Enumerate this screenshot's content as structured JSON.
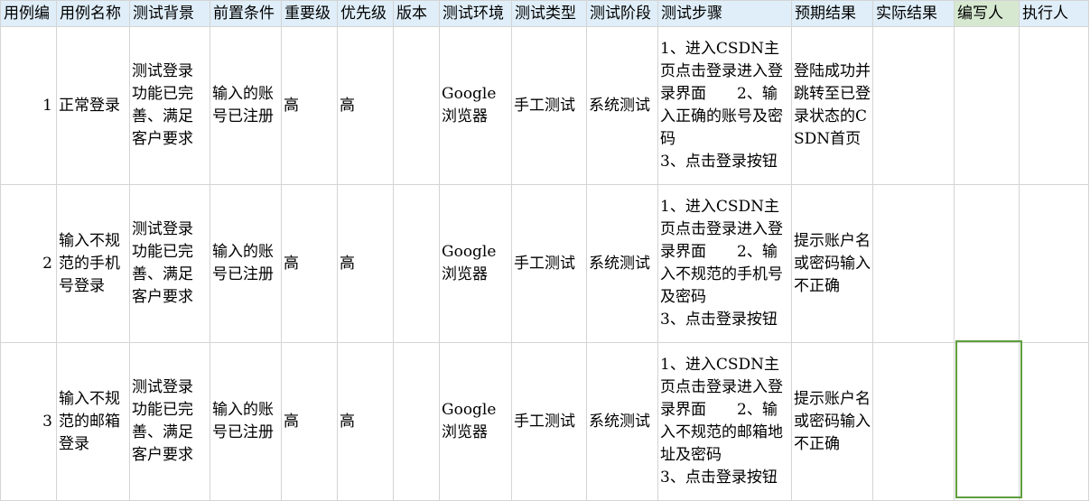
{
  "headers": [
    "用例编",
    "用例名称",
    "测试背景",
    "前置条件",
    "重要级",
    "优先级",
    "版本",
    "测试环境",
    "测试类型",
    "测试阶段",
    "测试步骤",
    "预期结果",
    "实际结果",
    "编写人",
    "执行人"
  ],
  "rows": [
    {
      "id": "1",
      "name": "正常登录",
      "background": "测试登录功能已完善、满足客户要求",
      "precondition": "输入的账号已注册",
      "importance": "高",
      "priority": "高",
      "version": "",
      "env": "Google浏览器",
      "type": "手工测试",
      "stage": "系统测试",
      "steps": "1、进入CSDN主页点击登录进入登录界面　　2、输入正确的账号及密码\n3、点击登录按钮",
      "expected": "登陆成功并跳转至已登录状态的CSDN首页",
      "actual": "",
      "author": "",
      "executor": ""
    },
    {
      "id": "2",
      "name": "输入不规范的手机号登录",
      "background": "测试登录功能已完善、满足客户要求",
      "precondition": "输入的账号已注册",
      "importance": "高",
      "priority": "高",
      "version": "",
      "env": "Google浏览器",
      "type": "手工测试",
      "stage": "系统测试",
      "steps": "1、进入CSDN主页点击登录进入登录界面　　2、输入不规范的手机号及密码\n3、点击登录按钮",
      "expected": "提示账户名或密码输入不正确",
      "actual": "",
      "author": "",
      "executor": ""
    },
    {
      "id": "3",
      "name": "输入不规范的邮箱登录",
      "background": "测试登录功能已完善、满足客户要求",
      "precondition": "输入的账号已注册",
      "importance": "高",
      "priority": "高",
      "version": "",
      "env": "Google浏览器",
      "type": "手工测试",
      "stage": "系统测试",
      "steps": "1、进入CSDN主页点击登录进入登录界面　　2、输入不规范的邮箱地址及密码\n3、点击登录按钮",
      "expected": "提示账户名或密码输入不正确",
      "actual": "",
      "author": "",
      "executor": ""
    }
  ],
  "colors": {
    "header_bg": "#dfeef8",
    "grid": "#d4d4d4",
    "selection": "#5e9e3e"
  }
}
